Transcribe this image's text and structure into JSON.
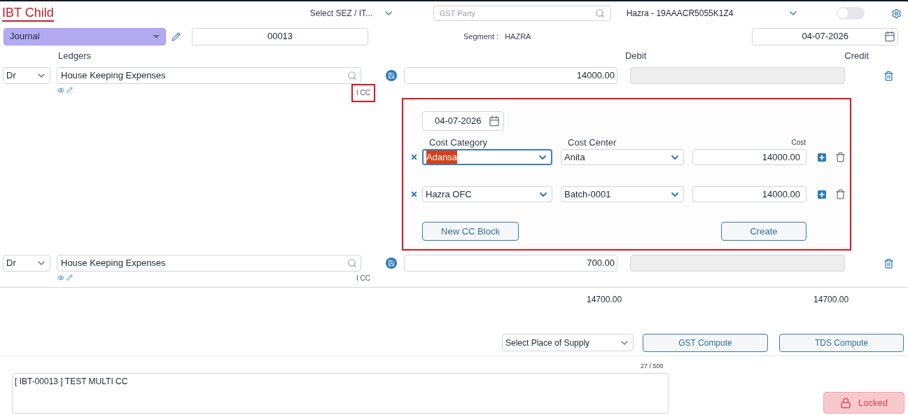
{
  "header": {
    "title": "IBT Child",
    "sez_select": "Select SEZ / IT...",
    "gst_party": {
      "placeholder": "GST Party"
    },
    "party": "Hazra - 19AAACR5055K1Z4",
    "toggle": {
      "on": false
    }
  },
  "voucher": {
    "type": "Journal",
    "number": "00013",
    "segment_label": "Segment :",
    "segment": "HAZRA",
    "date": "04-07-2026"
  },
  "columns": {
    "ledgers": "Ledgers",
    "debit": "Debit",
    "credit": "Credit"
  },
  "entries": [
    {
      "side": "Dr",
      "ledger": "House Keeping Expenses",
      "debit": "14000.00",
      "credit_disabled": true,
      "cc_label": "I CC",
      "cc_highlighted": true,
      "cc_panel": {
        "date": "04-07-2026",
        "headers": [
          "Cost Category",
          "Cost Center",
          "Cost"
        ],
        "rows": [
          {
            "category": "Adansa",
            "focused": true,
            "center": "Anita",
            "cost": "14000.00"
          },
          {
            "category": "Hazra OFC",
            "focused": false,
            "center": "Batch-0001",
            "cost": "14000.00"
          }
        ],
        "buttons": [
          "New CC Block",
          "Create"
        ]
      }
    },
    {
      "side": "Dr",
      "ledger": "House Keeping Expenses",
      "debit": "700.00",
      "credit_disabled": true,
      "cc_label": "I CC",
      "cc_highlighted": false
    }
  ],
  "totals": {
    "debit": "14700.00",
    "credit": "14700.00"
  },
  "actions": {
    "place_of_supply": "Select Place of Supply",
    "buttons": [
      "GST Compute",
      "TDS Compute"
    ]
  },
  "narration": {
    "counter": "27 / 500",
    "value": "[ IBT-00013 ] TEST MULTI CC"
  },
  "status": {
    "label": "Locked"
  }
}
